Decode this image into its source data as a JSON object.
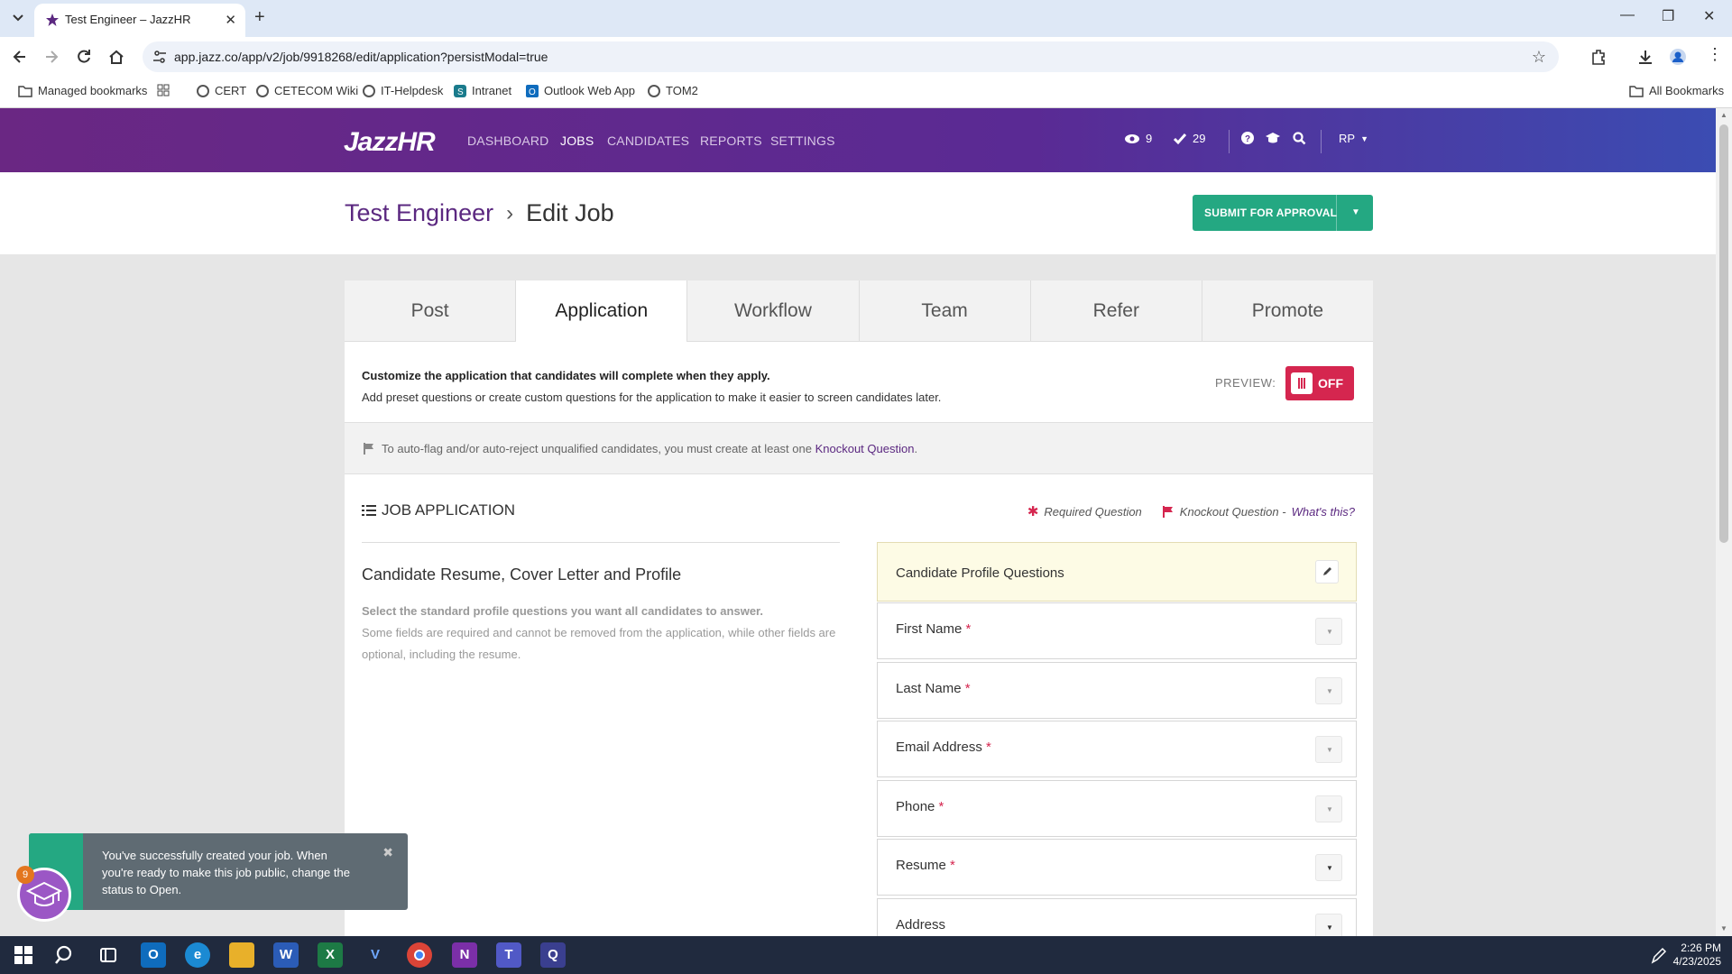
{
  "browser": {
    "tab_title": "Test Engineer – JazzHR",
    "url": "app.jazz.co/app/v2/job/9918268/edit/application?persistModal=true",
    "bookmarks": [
      "Managed bookmarks",
      "CERT",
      "CETECOM Wiki",
      "IT-Helpdesk",
      "Intranet",
      "Outlook Web App",
      "TOM2"
    ],
    "all_bookmarks": "All Bookmarks"
  },
  "app": {
    "logo": "JazzHR",
    "nav": [
      "DASHBOARD",
      "JOBS",
      "CANDIDATES",
      "REPORTS",
      "SETTINGS"
    ],
    "active_nav": "JOBS",
    "views_count": "9",
    "tasks_count": "29",
    "user_initials": "RP"
  },
  "header": {
    "job_title": "Test Engineer",
    "current": "Edit Job",
    "submit_label": "SUBMIT FOR APPROVAL"
  },
  "tabs": [
    "Post",
    "Application",
    "Workflow",
    "Team",
    "Refer",
    "Promote"
  ],
  "active_tab": "Application",
  "intro": {
    "title": "Customize the application that candidates will complete when they apply.",
    "text": "Add preset questions or create custom questions for the application to make it easier to screen candidates later."
  },
  "preview": {
    "label": "PREVIEW:",
    "state": "OFF"
  },
  "flag_notice": {
    "text": "To auto-flag and/or auto-reject unqualified candidates, you must create at least one",
    "link": "Knockout Question",
    "end": "."
  },
  "job_application": {
    "title": "JOB APPLICATION",
    "required_legend": "Required Question",
    "knockout_legend": "Knockout Question -",
    "whats_this": "What's this?"
  },
  "left": {
    "heading": "Candidate Resume, Cover Letter and Profile",
    "subheading": "Select the standard profile questions you want all candidates to answer.",
    "description": "Some fields are required and cannot be removed from the application, while other fields are optional, including the resume."
  },
  "profile_questions": {
    "title": "Candidate Profile Questions",
    "fields": [
      {
        "name": "First Name",
        "req": "*"
      },
      {
        "name": "Last Name",
        "req": "*"
      },
      {
        "name": "Email Address",
        "req": "*"
      },
      {
        "name": "Phone",
        "req": "*"
      },
      {
        "name": "Resume",
        "req": "*"
      },
      {
        "name": "Address",
        "req": ""
      }
    ]
  },
  "toast": {
    "message": "You've successfully created your job. When you're ready to make this job public, change the status to Open.",
    "badge": "9"
  },
  "taskbar": {
    "time": "2:26 PM",
    "date": "4/23/2025"
  },
  "colors": {
    "brand_purple": "#5b2880",
    "accent_green": "#24a882",
    "required_red": "#d5264f"
  }
}
